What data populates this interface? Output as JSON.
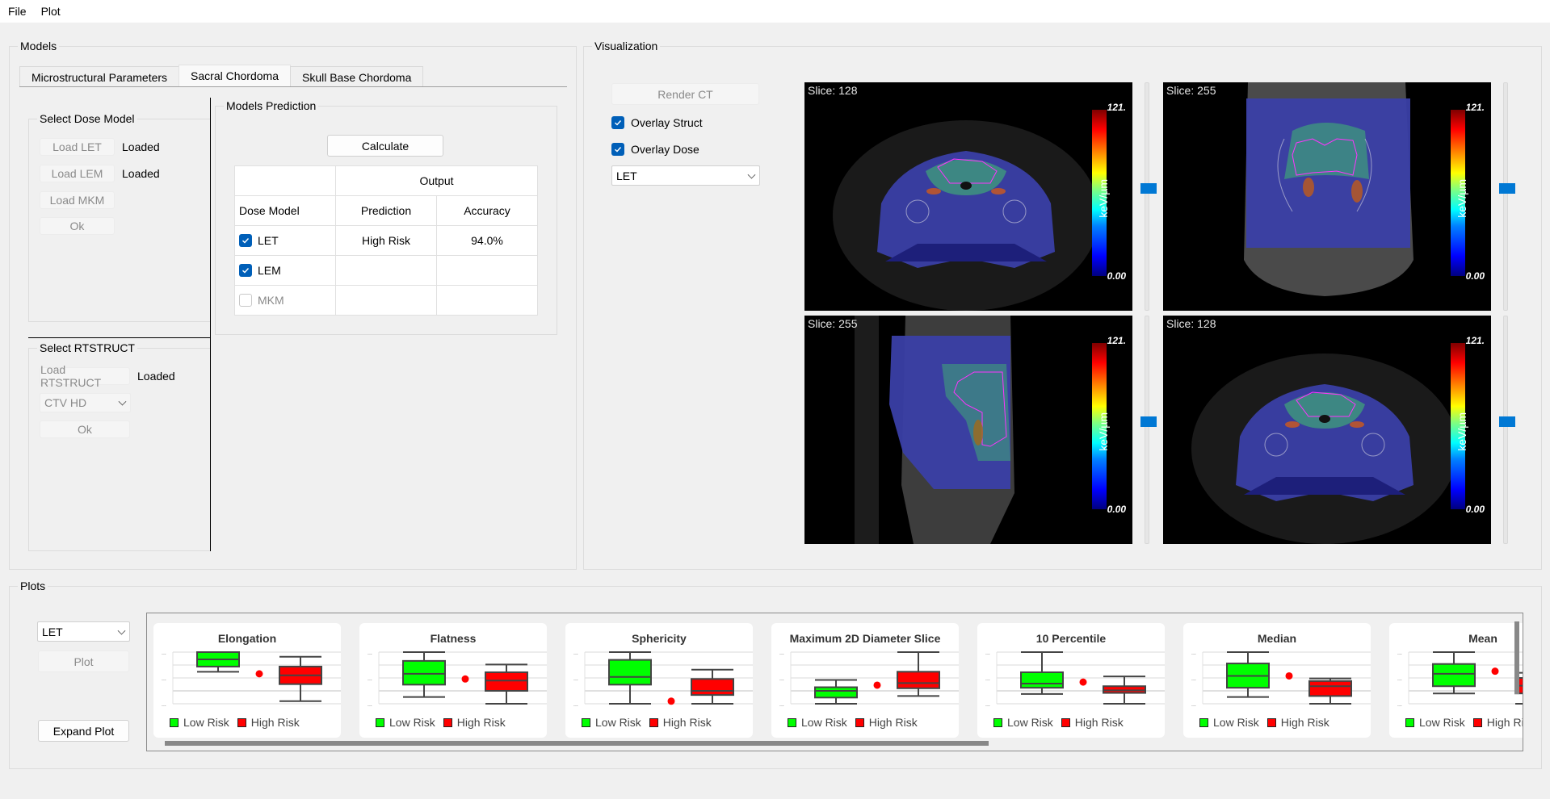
{
  "menu": [
    "File",
    "Plot"
  ],
  "models": {
    "title": "Models",
    "tabs": [
      {
        "label": "Microstructural Parameters",
        "active": false
      },
      {
        "label": "Sacral Chordoma",
        "active": true
      },
      {
        "label": "Skull Base Chordoma",
        "active": false
      }
    ],
    "dose_model": {
      "title": "Select Dose Model",
      "buttons": [
        {
          "label": "Load LET",
          "status": "Loaded"
        },
        {
          "label": "Load LEM",
          "status": "Loaded"
        },
        {
          "label": "Load MKM",
          "status": ""
        }
      ],
      "ok_label": "Ok"
    },
    "rtstruct": {
      "title": "Select RTSTRUCT",
      "load_label": "Load RTSTRUCT",
      "status": "Loaded",
      "structure_selected": "CTV HD",
      "ok_label": "Ok"
    },
    "prediction": {
      "title": "Models Prediction",
      "calculate_label": "Calculate",
      "header_group": "Output",
      "columns": [
        "Dose Model",
        "Prediction",
        "Accuracy"
      ],
      "rows": [
        {
          "model": "LET",
          "checked": true,
          "enabled": true,
          "prediction": "High Risk",
          "accuracy": "94.0%"
        },
        {
          "model": "LEM",
          "checked": true,
          "enabled": true,
          "prediction": "",
          "accuracy": ""
        },
        {
          "model": "MKM",
          "checked": false,
          "enabled": false,
          "prediction": "",
          "accuracy": ""
        }
      ]
    }
  },
  "visualization": {
    "title": "Visualization",
    "render_label": "Render CT",
    "overlay_struct_label": "Overlay Struct",
    "overlay_struct_checked": true,
    "overlay_dose_label": "Overlay Dose",
    "overlay_dose_checked": true,
    "dose_selected": "LET",
    "views": [
      {
        "slice": "Slice: 128",
        "orientation": "axial",
        "cmax": "121.",
        "cmin": "0.00",
        "unit": "keV/µm",
        "slider_fraction": 0.5
      },
      {
        "slice": "Slice: 255",
        "orientation": "coronal",
        "cmax": "121.",
        "cmin": "0.00",
        "unit": "keV/µm",
        "slider_fraction": 0.5
      },
      {
        "slice": "Slice: 255",
        "orientation": "sagittal",
        "cmax": "121.",
        "cmin": "0.00",
        "unit": "keV/µm",
        "slider_fraction": 0.5
      },
      {
        "slice": "Slice: 128",
        "orientation": "axial",
        "cmax": "121.",
        "cmin": "0.00",
        "unit": "keV/µm",
        "slider_fraction": 0.5
      }
    ]
  },
  "plots": {
    "title": "Plots",
    "dose_selected": "LET",
    "plot_label": "Plot",
    "expand_label": "Expand Plot",
    "legend": {
      "low": "Low Risk",
      "high": "High Risk"
    },
    "colors": {
      "low": "#00ff00",
      "high": "#ff0000",
      "patient": "#ff0000"
    },
    "horizontal_scroll_fraction": 0.6
  },
  "chart_data": [
    {
      "type": "box",
      "title": "Elongation",
      "ylim": [
        0,
        1
      ],
      "ytick_labels": [
        "...",
        "...",
        "..."
      ],
      "series": [
        {
          "name": "Low Risk",
          "min": 0.62,
          "q1": 0.72,
          "median": 0.86,
          "q3": 1.0,
          "max": 1.0
        },
        {
          "name": "High Risk",
          "min": 0.05,
          "q1": 0.38,
          "median": 0.55,
          "q3": 0.72,
          "max": 0.91
        }
      ],
      "patient_value": 0.58
    },
    {
      "type": "box",
      "title": "Flatness",
      "ylim": [
        0,
        1
      ],
      "ytick_labels": [
        "...",
        "...",
        "..."
      ],
      "series": [
        {
          "name": "Low Risk",
          "min": 0.13,
          "q1": 0.37,
          "median": 0.58,
          "q3": 0.83,
          "max": 1.0
        },
        {
          "name": "High Risk",
          "min": 0.0,
          "q1": 0.25,
          "median": 0.45,
          "q3": 0.61,
          "max": 0.76
        }
      ],
      "patient_value": 0.48
    },
    {
      "type": "box",
      "title": "Sphericity",
      "ylim": [
        0,
        1
      ],
      "ytick_labels": [
        "...",
        "...",
        "..."
      ],
      "series": [
        {
          "name": "Low Risk",
          "min": 0.0,
          "q1": 0.37,
          "median": 0.52,
          "q3": 0.85,
          "max": 1.0
        },
        {
          "name": "High Risk",
          "min": 0.0,
          "q1": 0.17,
          "median": 0.25,
          "q3": 0.48,
          "max": 0.66
        }
      ],
      "patient_value": 0.05
    },
    {
      "type": "box",
      "title": "Maximum 2D Diameter Slice",
      "ylim": [
        0,
        1
      ],
      "ytick_labels": [
        "...",
        "...",
        "..."
      ],
      "series": [
        {
          "name": "Low Risk",
          "min": 0.0,
          "q1": 0.12,
          "median": 0.25,
          "q3": 0.32,
          "max": 0.46
        },
        {
          "name": "High Risk",
          "min": 0.15,
          "q1": 0.3,
          "median": 0.4,
          "q3": 0.62,
          "max": 1.0
        }
      ],
      "patient_value": 0.36
    },
    {
      "type": "box",
      "title": "10 Percentile",
      "ylim": [
        0,
        1
      ],
      "ytick_labels": [
        "...",
        "...",
        "..."
      ],
      "series": [
        {
          "name": "Low Risk",
          "min": 0.19,
          "q1": 0.31,
          "median": 0.39,
          "q3": 0.61,
          "max": 1.0
        },
        {
          "name": "High Risk",
          "min": 0.0,
          "q1": 0.21,
          "median": 0.26,
          "q3": 0.34,
          "max": 0.53
        }
      ],
      "patient_value": 0.42
    },
    {
      "type": "box",
      "title": "Median",
      "ylim": [
        0,
        1
      ],
      "ytick_labels": [
        "...",
        "...",
        "..."
      ],
      "series": [
        {
          "name": "Low Risk",
          "min": 0.13,
          "q1": 0.31,
          "median": 0.54,
          "q3": 0.78,
          "max": 1.0
        },
        {
          "name": "High Risk",
          "min": 0.0,
          "q1": 0.15,
          "median": 0.34,
          "q3": 0.44,
          "max": 0.49
        }
      ],
      "patient_value": 0.54
    },
    {
      "type": "box",
      "title": "Mean",
      "ylim": [
        0,
        1
      ],
      "ytick_labels": [
        "...",
        "...",
        "..."
      ],
      "series": [
        {
          "name": "Low Risk",
          "min": 0.2,
          "q1": 0.34,
          "median": 0.58,
          "q3": 0.77,
          "max": 1.0
        },
        {
          "name": "High Risk",
          "min": 0.0,
          "q1": 0.2,
          "median": 0.35,
          "q3": 0.5,
          "max": 0.6
        }
      ],
      "patient_value": 0.63
    }
  ]
}
